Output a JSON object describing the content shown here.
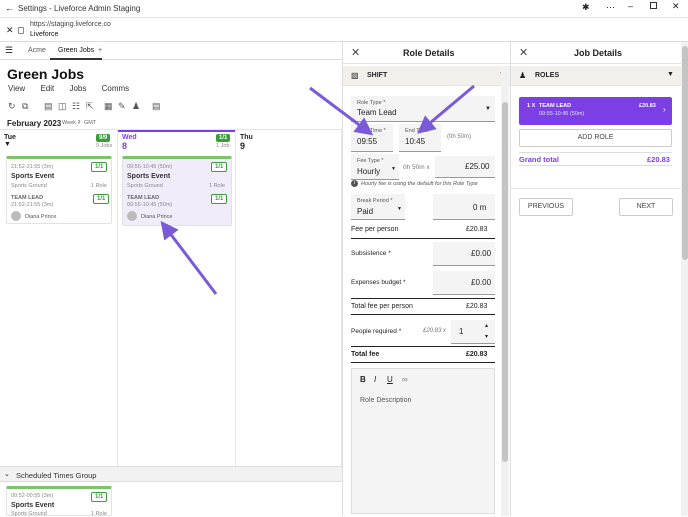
{
  "window": {
    "title": "Settings - Liveforce Admin Staging"
  },
  "url": {
    "address": "https://staging.liveforce.co",
    "site": "Liveforce"
  },
  "tabs": [
    {
      "label": "Acme"
    },
    {
      "label": "Green Jobs"
    },
    {
      "label": "+"
    }
  ],
  "page": {
    "title": "Green Jobs",
    "menu": [
      "View",
      "Edit",
      "Jobs",
      "Comms"
    ]
  },
  "calendar": {
    "month": "February 2023",
    "week": "Week 7",
    "tz": "GMT",
    "days": [
      {
        "name": "Tue",
        "num": "7",
        "badge": "9/9",
        "meta": "9 Jobs"
      },
      {
        "name": "Wed",
        "num": "8",
        "badge": "1/1",
        "meta": "1 Job"
      },
      {
        "name": "Thu",
        "num": "9",
        "badge": "",
        "meta": ""
      }
    ],
    "tue_card": {
      "time": "21:52-21:55 (3m)",
      "badge": "1/1",
      "name": "Sports Event",
      "venue": "Sports Ground",
      "roles": "1 Role",
      "role": "TEAM LEAD",
      "role_badge": "1/1",
      "role_time": "21:52-21:55 (3m)",
      "person": "Diana Prince"
    },
    "wed_card": {
      "time": "09:55-10:45 (50m)",
      "badge": "1/1",
      "name": "Sports Event",
      "venue": "Sports Ground",
      "roles": "1 Role",
      "role": "TEAM LEAD",
      "role_badge": "1/1",
      "role_time": "09:55-10:45 (50m)",
      "person": "Diana Prince"
    },
    "group": "Scheduled Times Group",
    "group_card": {
      "time": "00:52-00:55 (3m)",
      "badge": "1/1",
      "name": "Sports Event",
      "venue": "Sports Ground",
      "roles": "1 Role"
    }
  },
  "role": {
    "title": "Role Details",
    "section": "SHIFT",
    "role_type_label": "Role Type *",
    "role_type": "Team Lead",
    "start_label": "Start Time *",
    "start": "09:55",
    "end_label": "End Time *",
    "end": "10:45",
    "duration": "(0h 50m)",
    "fee_type_label": "Fee Type *",
    "fee_type": "Hourly",
    "fee_calc": "0h 50m x",
    "fee_rate": "£25.00",
    "hint": "Hourly fee is using the default for this Role Type",
    "break_label": "Break Period *",
    "break": "Paid",
    "break_val": "0 m",
    "fee_per_person_label": "Fee per person",
    "fee_per_person": "£20.83",
    "subsistence_label": "Subsistence *",
    "subsistence": "£0.00",
    "expenses_label": "Expenses budget *",
    "expenses": "£0.00",
    "total_pp_label": "Total fee per person",
    "total_pp": "£20.83",
    "people_label": "People required *",
    "people_calc": "£20.83 x",
    "people": "1",
    "total_label": "Total fee",
    "total": "£20.83",
    "desc_placeholder": "Role Description",
    "format": [
      "B",
      "I",
      "U"
    ]
  },
  "job": {
    "title": "Job Details",
    "section": "ROLES",
    "role_qty": "1 X",
    "role_name": "TEAM LEAD",
    "role_price": "£20.83",
    "role_time": "09:55-10:45 (50m)",
    "add_role": "ADD ROLE",
    "grand_label": "Grand total",
    "grand": "£20.83",
    "prev": "PREVIOUS",
    "next": "NEXT"
  },
  "colors": {
    "accent": "#7b3fe4",
    "green": "#3a9c3a",
    "arrow": "#7a5ad8"
  }
}
